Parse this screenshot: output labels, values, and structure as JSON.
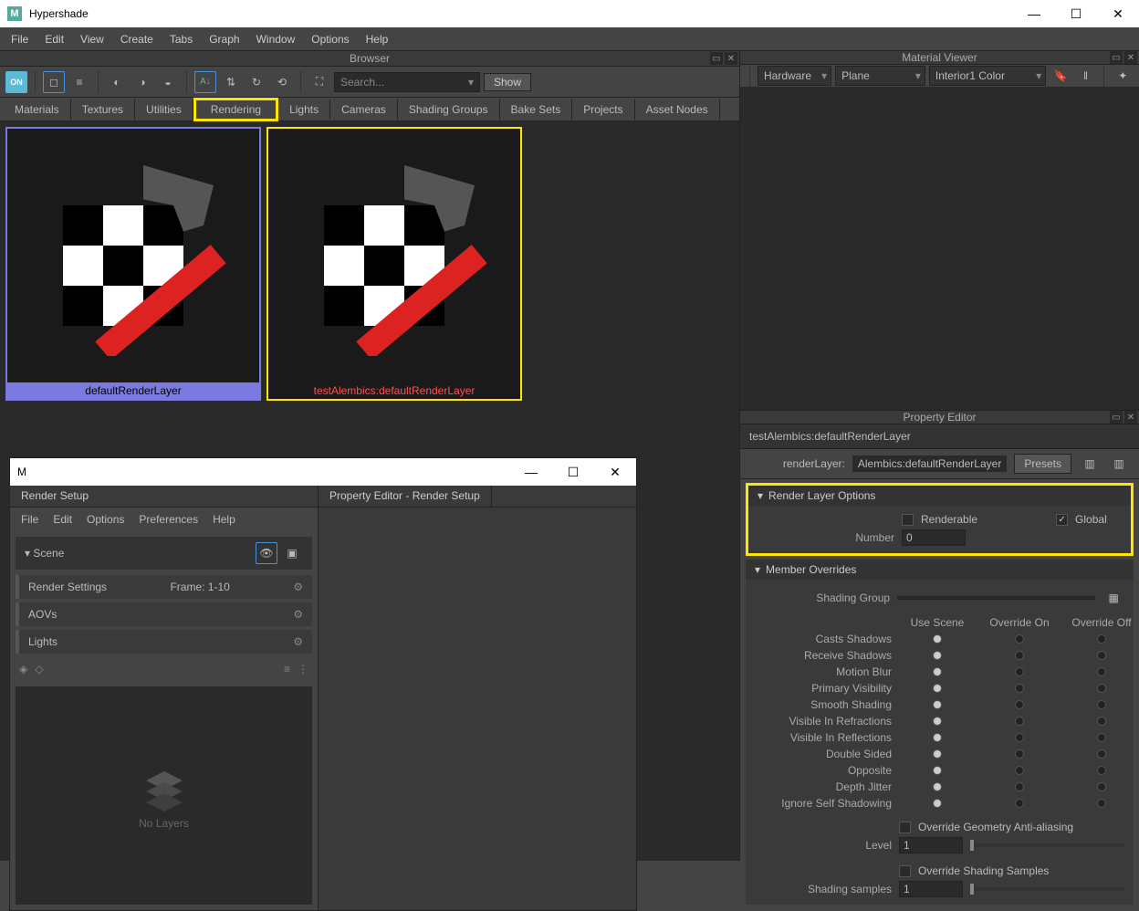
{
  "window": {
    "title": "Hypershade"
  },
  "menubar": [
    "File",
    "Edit",
    "View",
    "Create",
    "Tabs",
    "Graph",
    "Window",
    "Options",
    "Help"
  ],
  "browser": {
    "title": "Browser",
    "search_placeholder": "Search...",
    "show_label": "Show",
    "tabs": [
      "Materials",
      "Textures",
      "Utilities",
      "Rendering",
      "Lights",
      "Cameras",
      "Shading Groups",
      "Bake Sets",
      "Projects",
      "Asset Nodes"
    ],
    "active_tab": "Rendering",
    "swatches": [
      {
        "label": "defaultRenderLayer"
      },
      {
        "label": "testAlembics:defaultRenderLayer"
      }
    ]
  },
  "render_setup": {
    "tab1": "Render Setup",
    "tab2": "Property Editor - Render Setup",
    "menu": [
      "File",
      "Edit",
      "Options",
      "Preferences",
      "Help"
    ],
    "scene": "Scene",
    "rows": [
      {
        "label": "Render Settings",
        "extra": "Frame: 1-10"
      },
      {
        "label": "AOVs",
        "extra": ""
      },
      {
        "label": "Lights",
        "extra": ""
      }
    ],
    "no_layers": "No Layers"
  },
  "material_viewer": {
    "title": "Material Viewer",
    "hardware": "Hardware",
    "geometry": "Plane",
    "env": "Interior1 Color"
  },
  "property_editor": {
    "title": "Property Editor",
    "node": "testAlembics:defaultRenderLayer",
    "layer_label": "renderLayer:",
    "layer_value": "Alembics:defaultRenderLayer",
    "presets": "Presets",
    "sections": {
      "render_layer_options": {
        "title": "Render Layer Options",
        "renderable": "Renderable",
        "global": "Global",
        "number_label": "Number",
        "number_value": "0"
      },
      "member_overrides": {
        "title": "Member Overrides",
        "shading_group": "Shading Group",
        "cols": [
          "Use Scene",
          "Override On",
          "Override Off"
        ],
        "rows": [
          "Casts Shadows",
          "Receive Shadows",
          "Motion Blur",
          "Primary Visibility",
          "Smooth Shading",
          "Visible In Refractions",
          "Visible In Reflections",
          "Double Sided",
          "Opposite",
          "Depth Jitter",
          "Ignore Self Shadowing"
        ],
        "geom_aa": "Override Geometry Anti-aliasing",
        "level_label": "Level",
        "level_value": "1",
        "shading_samples": "Override Shading Samples",
        "shading_samples_label": "Shading samples",
        "shading_samples_value": "1"
      }
    }
  }
}
